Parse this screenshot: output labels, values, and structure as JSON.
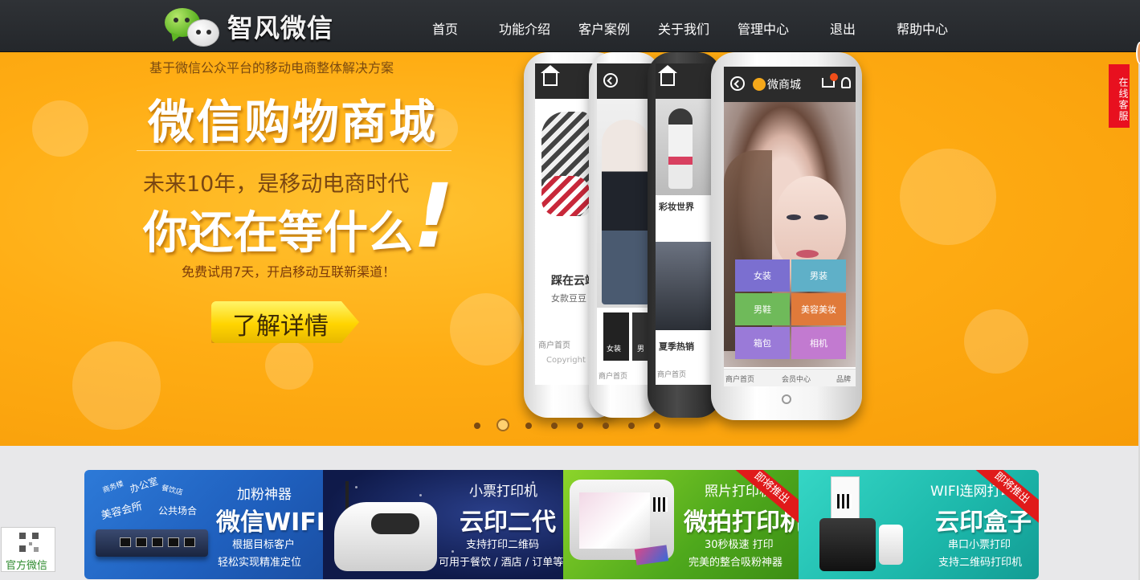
{
  "header": {
    "logo_text": "智风微信",
    "nav": [
      {
        "label": "首页"
      },
      {
        "label": "功能介绍"
      },
      {
        "label": "客户案例"
      },
      {
        "label": "关于我们"
      },
      {
        "label": "管理中心"
      },
      {
        "label": "退出"
      },
      {
        "label": "帮助中心"
      }
    ]
  },
  "banner": {
    "subtitle": "基于微信公众平台的移动电商整体解决方案",
    "title": "微信购物商城",
    "line1": "未来10年，是移动电商时代",
    "line2": "你还在等什么",
    "exclaim": "!",
    "note": "免费试用7天，开启移动互联新渠道！",
    "cta_label": "了解详情",
    "slides_count": 8,
    "active_slide": 2
  },
  "phones": {
    "main": {
      "app_name": "微商城",
      "cart_badge": "1",
      "tiles": [
        "女装",
        "男装",
        "男鞋",
        "美容美妆",
        "箱包",
        "相机"
      ],
      "tile_colors": [
        "#7b6fd0",
        "#5fb0c8",
        "#6fba5a",
        "#e07a3a",
        "#9a7ad8",
        "#c27ad0"
      ],
      "footer": [
        "商户首页",
        "会员中心",
        "品牌"
      ]
    },
    "second": {
      "section_title": "彩妆世界",
      "bottom_label": "夏季热销",
      "footer": "商户首页"
    },
    "third": {
      "tab_labels": [
        "女装",
        "男"
      ],
      "footer": "商户首页"
    },
    "fourth": {
      "headline": "踩在云端",
      "sub": "女款豆豆",
      "footer": "商户首页",
      "copyright": "Copyright"
    }
  },
  "service_tab": {
    "label": "在线客服"
  },
  "cards": [
    {
      "kicker": "加粉神器",
      "headline": "微信WIFI",
      "desc1": "根据目标客户",
      "desc2": "轻松实现精准定位",
      "tags": [
        "办公室",
        "美容会所",
        "公共场合",
        "商务楼",
        "餐饮店"
      ],
      "color": "#2d7ad8"
    },
    {
      "kicker": "小票打印机",
      "headline": "云印二代",
      "desc1": "支持打印二维码",
      "desc2": "可用于餐饮 / 酒店 / 订单等",
      "color": "#1a2a66"
    },
    {
      "kicker": "照片打印机",
      "headline": "微拍打印机",
      "desc1": "30秒极速 打印",
      "desc2": "完美的整合吸粉神器",
      "ribbon": "即将推出",
      "color": "#6cc024"
    },
    {
      "kicker": "WIFI连网打印",
      "headline": "云印盒子",
      "desc1": "串口小票打印",
      "desc2": "支持二维码打印机",
      "ribbon": "即将推出",
      "color": "#1fc0b2"
    }
  ],
  "qr_badge": {
    "label": "官方微信"
  }
}
